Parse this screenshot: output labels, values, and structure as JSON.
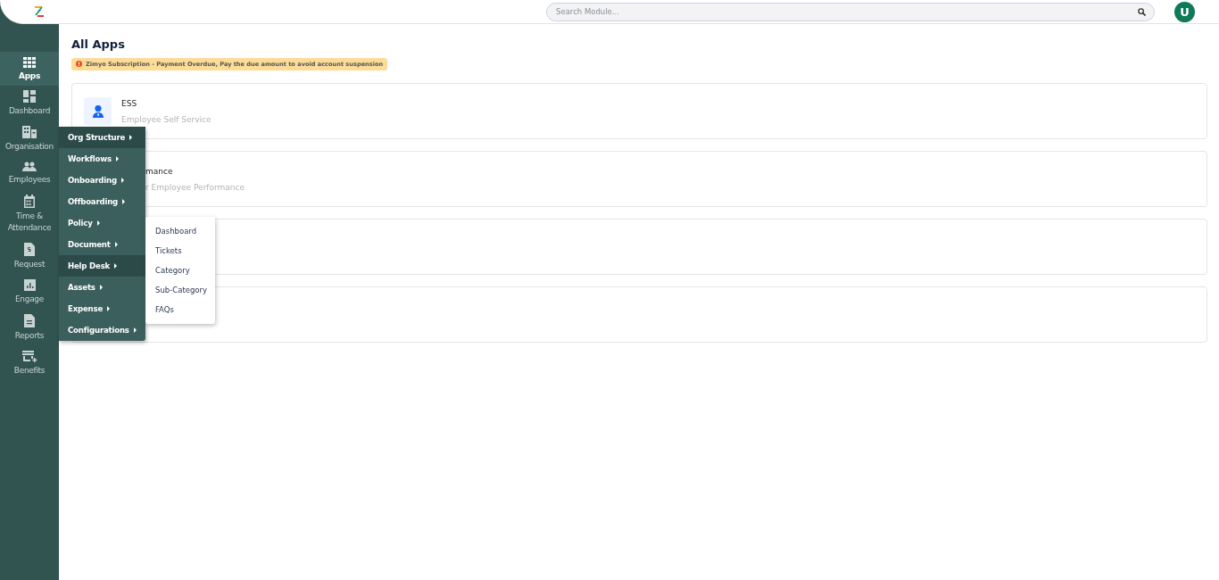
{
  "header": {
    "search": {
      "placeholder": "Search Module..."
    },
    "avatar": "U"
  },
  "sidebar": {
    "items": [
      {
        "label": "Apps",
        "selected": true
      },
      {
        "label": "Dashboard",
        "selected": false
      },
      {
        "label": "Organisation",
        "selected": false
      },
      {
        "label": "Employees",
        "selected": false
      },
      {
        "label": "Time & Attendance",
        "selected": false
      },
      {
        "label": "Request",
        "selected": false
      },
      {
        "label": "Engage",
        "selected": false
      },
      {
        "label": "Reports",
        "selected": false
      },
      {
        "label": "Benefits",
        "selected": false
      }
    ]
  },
  "page": {
    "title": "All Apps",
    "alert": "Zimyo Subscription - Payment Overdue, Pay the due amount to avoid account suspension"
  },
  "cards": [
    {
      "kind": "app",
      "title": "ESS",
      "subtitle": "Employee Self Service"
    },
    {
      "kind": "covered",
      "title": "mance",
      "subtitle": "r Employee Performance"
    },
    {
      "kind": "blank"
    },
    {
      "kind": "blank"
    }
  ],
  "menu": {
    "items": [
      {
        "label": "Org Structure",
        "highlighted": true
      },
      {
        "label": "Workflows",
        "highlighted": false
      },
      {
        "label": "Onboarding",
        "highlighted": false
      },
      {
        "label": "Offboarding",
        "highlighted": false
      },
      {
        "label": "Policy",
        "highlighted": false
      },
      {
        "label": "Document",
        "highlighted": false
      },
      {
        "label": "Help Desk",
        "highlighted": true,
        "expanded": true,
        "children": [
          {
            "label": "Dashboard"
          },
          {
            "label": "Tickets"
          },
          {
            "label": "Category"
          },
          {
            "label": "Sub-Category"
          },
          {
            "label": "FAQs"
          }
        ]
      },
      {
        "label": "Assets",
        "highlighted": false
      },
      {
        "label": "Expense",
        "highlighted": false
      },
      {
        "label": "Configurations",
        "highlighted": false
      }
    ]
  }
}
